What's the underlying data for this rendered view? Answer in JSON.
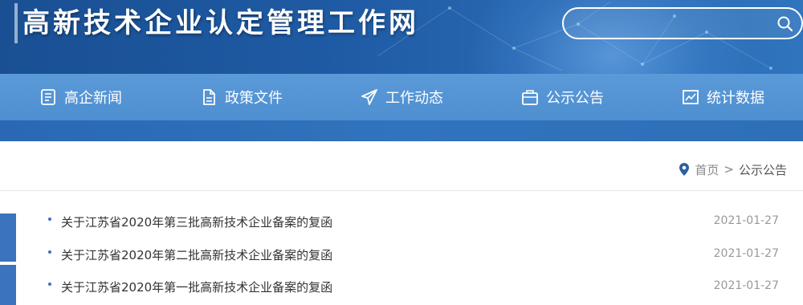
{
  "header": {
    "site_title": "高新技术企业认定管理工作网",
    "search": {
      "placeholder": ""
    }
  },
  "nav": {
    "items": [
      {
        "label": "高企新闻",
        "icon": "news-icon"
      },
      {
        "label": "政策文件",
        "icon": "document-icon"
      },
      {
        "label": "工作动态",
        "icon": "paper-plane-icon"
      },
      {
        "label": "公示公告",
        "icon": "notice-board-icon"
      },
      {
        "label": "统计数据",
        "icon": "chart-icon"
      }
    ]
  },
  "breadcrumb": {
    "home": "首页",
    "separator": ">",
    "current": "公示公告"
  },
  "list": {
    "items": [
      {
        "title": "关于江苏省2020年第三批高新技术企业备案的复函",
        "date": "2021-01-27"
      },
      {
        "title": "关于江苏省2020年第二批高新技术企业备案的复函",
        "date": "2021-01-27"
      },
      {
        "title": "关于江苏省2020年第一批高新技术企业备案的复函",
        "date": "2021-01-27"
      }
    ]
  },
  "colors": {
    "banner": "#1f5fa8",
    "nav": "#5b9ad8",
    "accent": "#3b73bf",
    "text": "#333333",
    "muted": "#999999"
  }
}
